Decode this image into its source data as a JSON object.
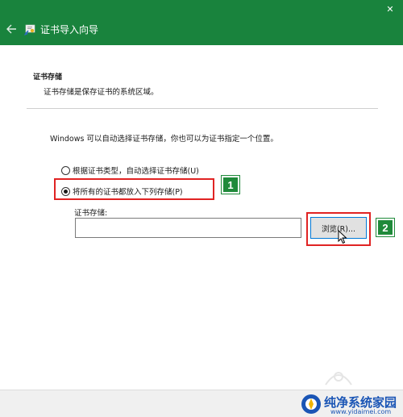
{
  "window": {
    "title": "证书导入向导",
    "accent_color": "#19833d",
    "back_icon": "back-arrow-icon",
    "app_icon": "certificate-icon",
    "close_icon": "close-icon"
  },
  "header": {
    "section_title": "证书存储",
    "section_desc": "证书存储是保存证书的系统区域。"
  },
  "main": {
    "intro": "Windows 可以自动选择证书存储，你也可以为证书指定一个位置。",
    "options": [
      {
        "label": "根据证书类型，自动选择证书存储(U)",
        "selected": false
      },
      {
        "label": "将所有的证书都放入下列存储(P)",
        "selected": true
      }
    ],
    "store_label": "证书存储:",
    "store_value": "",
    "browse_label": "浏览(R)..."
  },
  "annotations": {
    "badge_1": "1",
    "badge_2": "2",
    "highlight_color": "#e02323",
    "badge_color": "#1f8a3a"
  },
  "watermark": {
    "title": "纯净系统家园",
    "url": "www.yidaimei.com"
  }
}
